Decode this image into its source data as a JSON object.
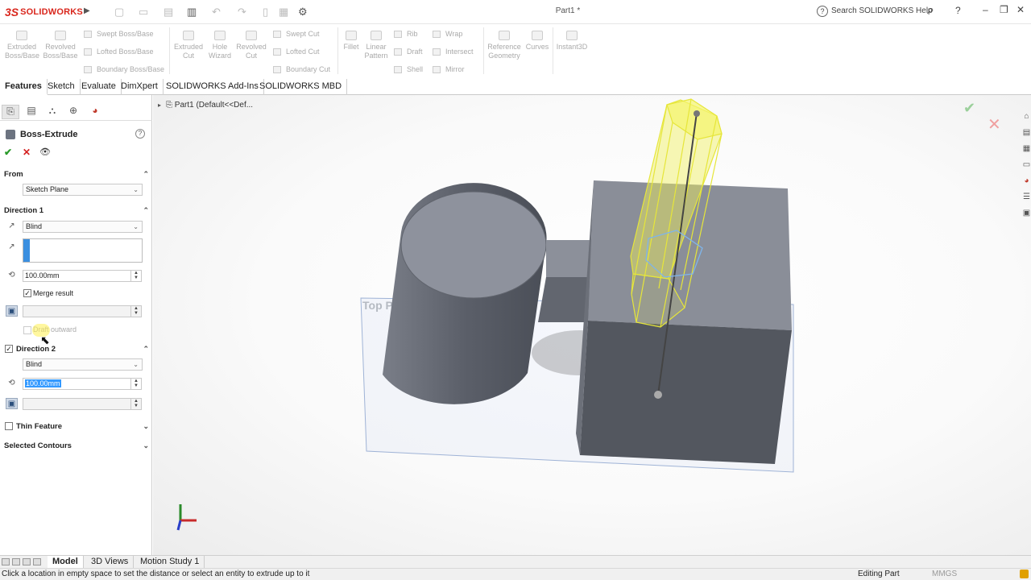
{
  "app": {
    "brand": "SOLIDWORKS",
    "brand_prefix": "3S",
    "doc_title": "Part1 *"
  },
  "titlebar": {
    "search_placeholder": "Search SOLIDWORKS Help",
    "help_label": "?"
  },
  "command_manager": {
    "extruded_boss": "Extruded\nBoss/Base",
    "revolved_boss": "Revolved\nBoss/Base",
    "swept_boss": "Swept Boss/Base",
    "lofted_boss": "Lofted Boss/Base",
    "boundary_boss": "Boundary Boss/Base",
    "extruded_cut": "Extruded\nCut",
    "hole_wizard": "Hole\nWizard",
    "revolved_cut": "Revolved\nCut",
    "swept_cut": "Swept Cut",
    "lofted_cut": "Lofted Cut",
    "boundary_cut": "Boundary Cut",
    "fillet": "Fillet",
    "linear_pattern": "Linear\nPattern",
    "rib": "Rib",
    "draft": "Draft",
    "shell": "Shell",
    "wrap": "Wrap",
    "intersect": "Intersect",
    "mirror": "Mirror",
    "reference_geometry": "Reference\nGeometry",
    "curves": "Curves",
    "instant3d": "Instant3D"
  },
  "tabs": [
    "Features",
    "Sketch",
    "Evaluate",
    "DimXpert",
    "SOLIDWORKS Add-Ins",
    "SOLIDWORKS MBD"
  ],
  "property_manager": {
    "title": "Boss-Extrude",
    "from": {
      "heading": "From",
      "value": "Sketch Plane"
    },
    "direction1": {
      "heading": "Direction 1",
      "end_condition": "Blind",
      "depth": "100.00mm",
      "merge_result_label": "Merge result",
      "merge_result_checked": true,
      "draft_outward_label": "Draft outward",
      "draft_outward_checked": false
    },
    "direction2": {
      "heading": "Direction 2",
      "checked": true,
      "end_condition": "Blind",
      "depth": "100.00mm"
    },
    "thin_feature": {
      "heading": "Thin Feature",
      "checked": false
    },
    "selected_contours": {
      "heading": "Selected Contours"
    }
  },
  "viewport": {
    "tree_root": "Part1  (Default<<Def...",
    "plane_label": "Top Plane"
  },
  "bottom_tabs": [
    "Model",
    "3D Views",
    "Motion Study 1"
  ],
  "status": {
    "message": "Click a location in empty space to set the distance or select an entity to extrude up to it",
    "mode": "Editing Part",
    "units": "MMGS"
  },
  "colors": {
    "brand_red": "#d9261c",
    "preview_yellow": "#e8e84a",
    "body_gray": "#6a6e78",
    "selection_blue": "#3399ff"
  }
}
